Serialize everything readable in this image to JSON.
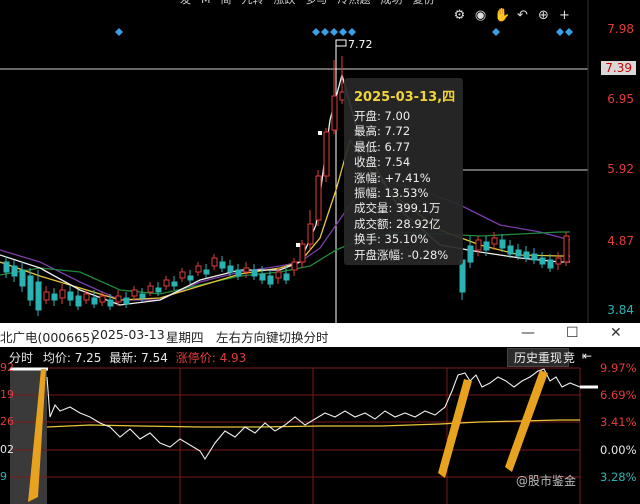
{
  "toolbar": {
    "items": [
      "发",
      "M",
      "简",
      "九转",
      "涨跌",
      "多与",
      "冷热题",
      "成功",
      "复仿",
      "",
      "加密",
      "多"
    ],
    "icons": [
      "gear-icon",
      "eye-icon",
      "hand-icon",
      "undo-icon",
      "plus-circle-icon",
      "cross-icon"
    ]
  },
  "price_axis": {
    "p1": "7.98",
    "current": "7.39",
    "p2": "6.95",
    "p3": "5.92",
    "p4": "4.87",
    "p5": "3.84"
  },
  "chart": {
    "high_label": "7.72"
  },
  "tooltip": {
    "date": "2025-03-13,四",
    "rows": [
      "开盘: 7.00",
      "最高: 7.72",
      "最低: 6.77",
      "收盘: 7.54",
      "涨幅: +7.41%",
      "振幅: 13.53%",
      "成交量: 399.1万",
      "成交额: 28.92亿",
      "换手: 35.10%",
      "开盘涨幅: -0.28%"
    ]
  },
  "titlebar": {
    "stock": "北广电(000665)",
    "date": "2025-03-13",
    "weekday": "星期四",
    "hint": "左右方向键切换分时"
  },
  "intraday": {
    "mode": "分时",
    "avg_label": "均价:",
    "avg_value": "7.25",
    "last_label": "最新:",
    "last_value": "7.54",
    "limit_label": "涨停价:",
    "limit_value": "4.93",
    "history_button": "历史重现",
    "jing_label": "竞",
    "right_pct": [
      "9.97%",
      "6.69%",
      "3.41%",
      "0.00%",
      "3.28%"
    ],
    "left_labels": [
      "92",
      "19",
      "26",
      "02",
      "9"
    ]
  },
  "watermark": "@股市鉴金",
  "colors": {
    "up": "#e23b3b",
    "down": "#2bb3b3",
    "accent_yellow": "#f1d43a",
    "arrow": "#e7a21f"
  }
}
